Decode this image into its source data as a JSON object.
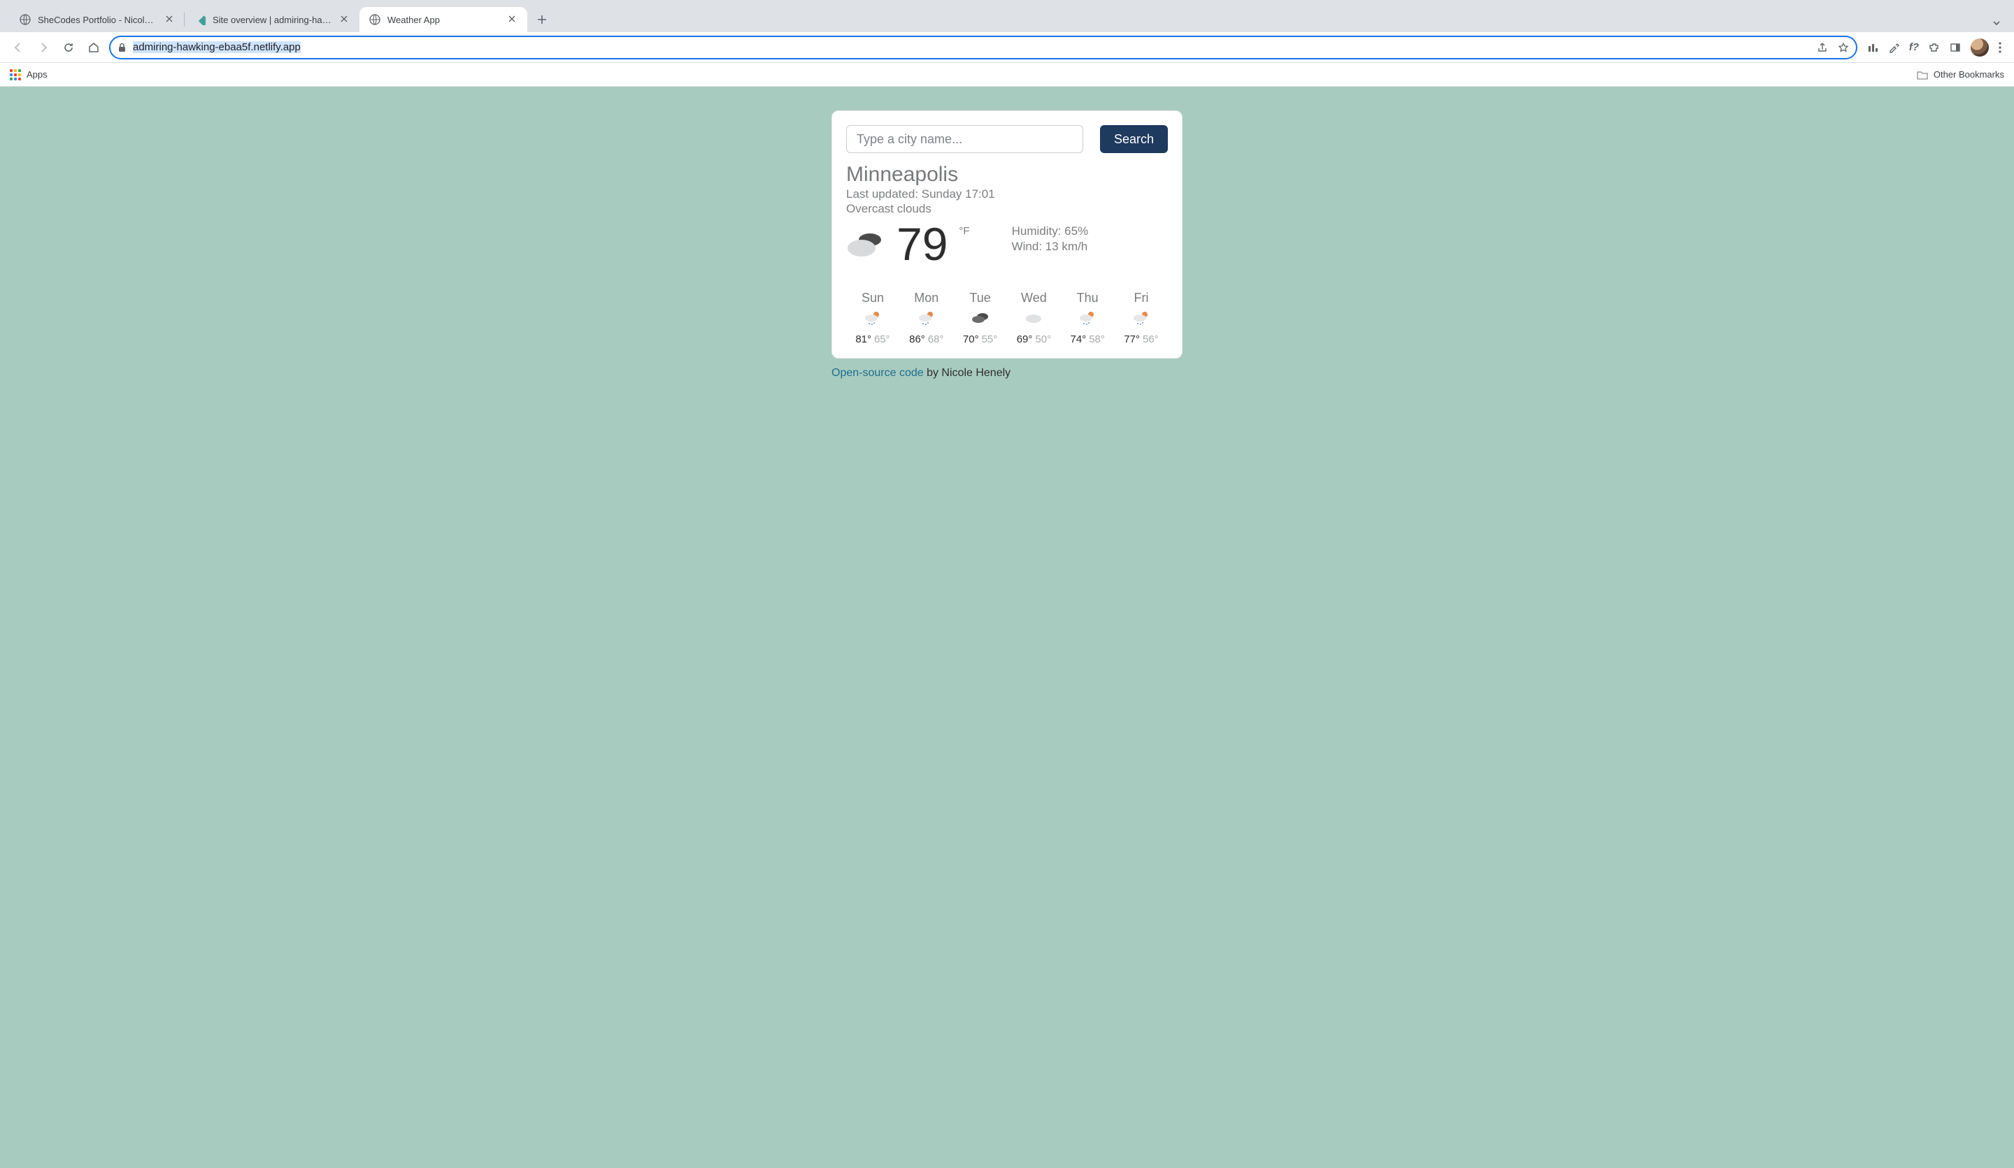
{
  "browser": {
    "tabs": [
      {
        "title": "SheCodes Portfolio - Nicole He",
        "active": false,
        "favicon": "globe"
      },
      {
        "title": "Site overview | admiring-hawki",
        "active": false,
        "favicon": "netlify"
      },
      {
        "title": "Weather App",
        "active": true,
        "favicon": "globe"
      }
    ],
    "url": "admiring-hawking-ebaa5f.netlify.app",
    "bookmarks_bar": {
      "apps_label": "Apps",
      "other_label": "Other Bookmarks"
    }
  },
  "search": {
    "placeholder": "Type a city name...",
    "button": "Search"
  },
  "weather": {
    "city": "Minneapolis",
    "last_updated_line": "Last updated: Sunday 17:01",
    "conditions": "Overcast clouds",
    "temp": "79",
    "unit": "°F",
    "humidity_line": "Humidity: 65%",
    "wind_line": "Wind: 13 km/h",
    "icon": "overcast"
  },
  "forecast": [
    {
      "day": "Sun",
      "hi": "81°",
      "lo": "65°",
      "icon": "rain-sun"
    },
    {
      "day": "Mon",
      "hi": "86°",
      "lo": "68°",
      "icon": "rain-sun"
    },
    {
      "day": "Tue",
      "hi": "70°",
      "lo": "55°",
      "icon": "dark-cloud"
    },
    {
      "day": "Wed",
      "hi": "69°",
      "lo": "50°",
      "icon": "cloud"
    },
    {
      "day": "Thu",
      "hi": "74°",
      "lo": "58°",
      "icon": "rain-sun"
    },
    {
      "day": "Fri",
      "hi": "77°",
      "lo": "56°",
      "icon": "rain-sun"
    }
  ],
  "credit": {
    "link_text": "Open-source code",
    "rest": " by Nicole Henely"
  }
}
